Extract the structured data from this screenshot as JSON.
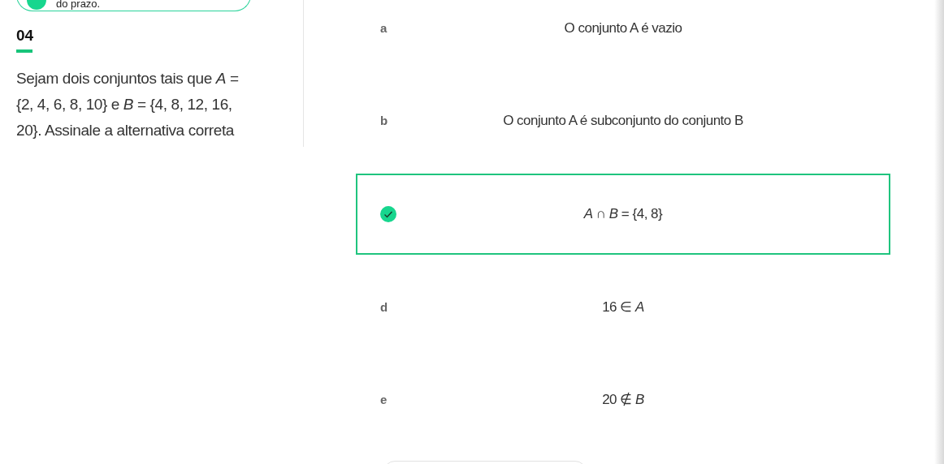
{
  "notice": {
    "text": "do prazo."
  },
  "question": {
    "number": "04",
    "text": "Sejam dois conjuntos tais que *A* = {2, 4, 6, 8, 10} e *B* = {4, 8, 12, 16, 20}. Assinale a alternativa correta"
  },
  "options": [
    {
      "letter": "a",
      "text": "O conjunto A é vazio",
      "selected": false
    },
    {
      "letter": "b",
      "text": "O conjunto A é subconjunto do conjunto B",
      "selected": false
    },
    {
      "text": "*A* ∩ *B* = {4, 8}",
      "selected": true
    },
    {
      "letter": "d",
      "text": "16 ∈ *A*",
      "selected": false
    },
    {
      "letter": "e",
      "text": "20 ∉ *B*",
      "selected": false
    }
  ]
}
